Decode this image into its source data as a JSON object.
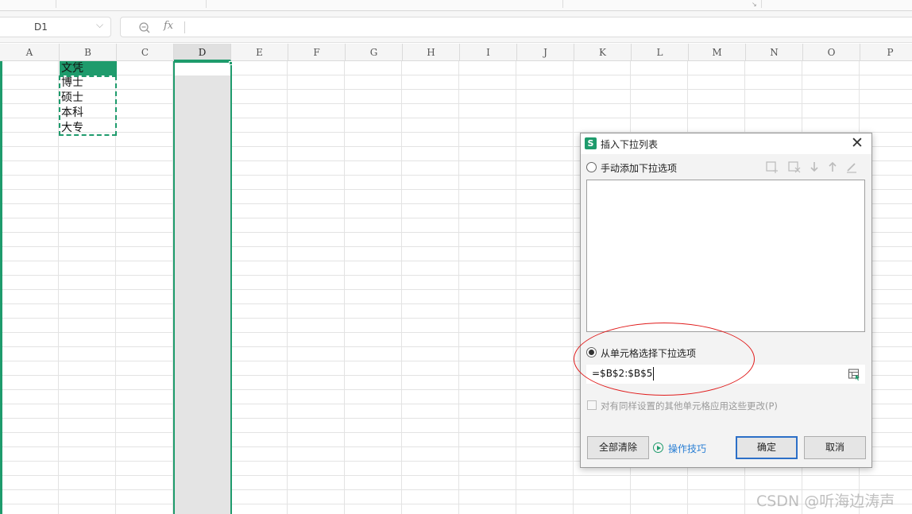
{
  "formula_bar": {
    "name_box": "D1",
    "fx_label": "fx",
    "formula": ""
  },
  "columns": [
    "A",
    "B",
    "C",
    "D",
    "E",
    "F",
    "G",
    "H",
    "I",
    "J",
    "K",
    "L",
    "M",
    "N",
    "O",
    "P"
  ],
  "selected_column": "D",
  "cells_b": [
    "文凭",
    "博士",
    "硕士",
    "本科",
    "大专"
  ],
  "dialog": {
    "title": "插入下拉列表",
    "app_badge": "S",
    "close_glyph": "✕",
    "manual_option_label": "手动添加下拉选项",
    "cell_option_label": "从单元格选择下拉选项",
    "cell_option_checked": true,
    "reference": "=$B$2:$B$5",
    "apply_all_label": "对有同样设置的其他单元格应用这些更改(P)",
    "clear_all_button": "全部清除",
    "tips_link": "操作技巧",
    "ok_button": "确定",
    "cancel_button": "取消",
    "toolbar_icons": [
      "add-item-icon",
      "delete-item-icon",
      "move-down-icon",
      "move-up-icon",
      "edit-item-icon"
    ]
  },
  "annotation_color": "#e01b1b",
  "accent_color": "#1e9b6c",
  "watermark": "CSDN @听海边涛声"
}
